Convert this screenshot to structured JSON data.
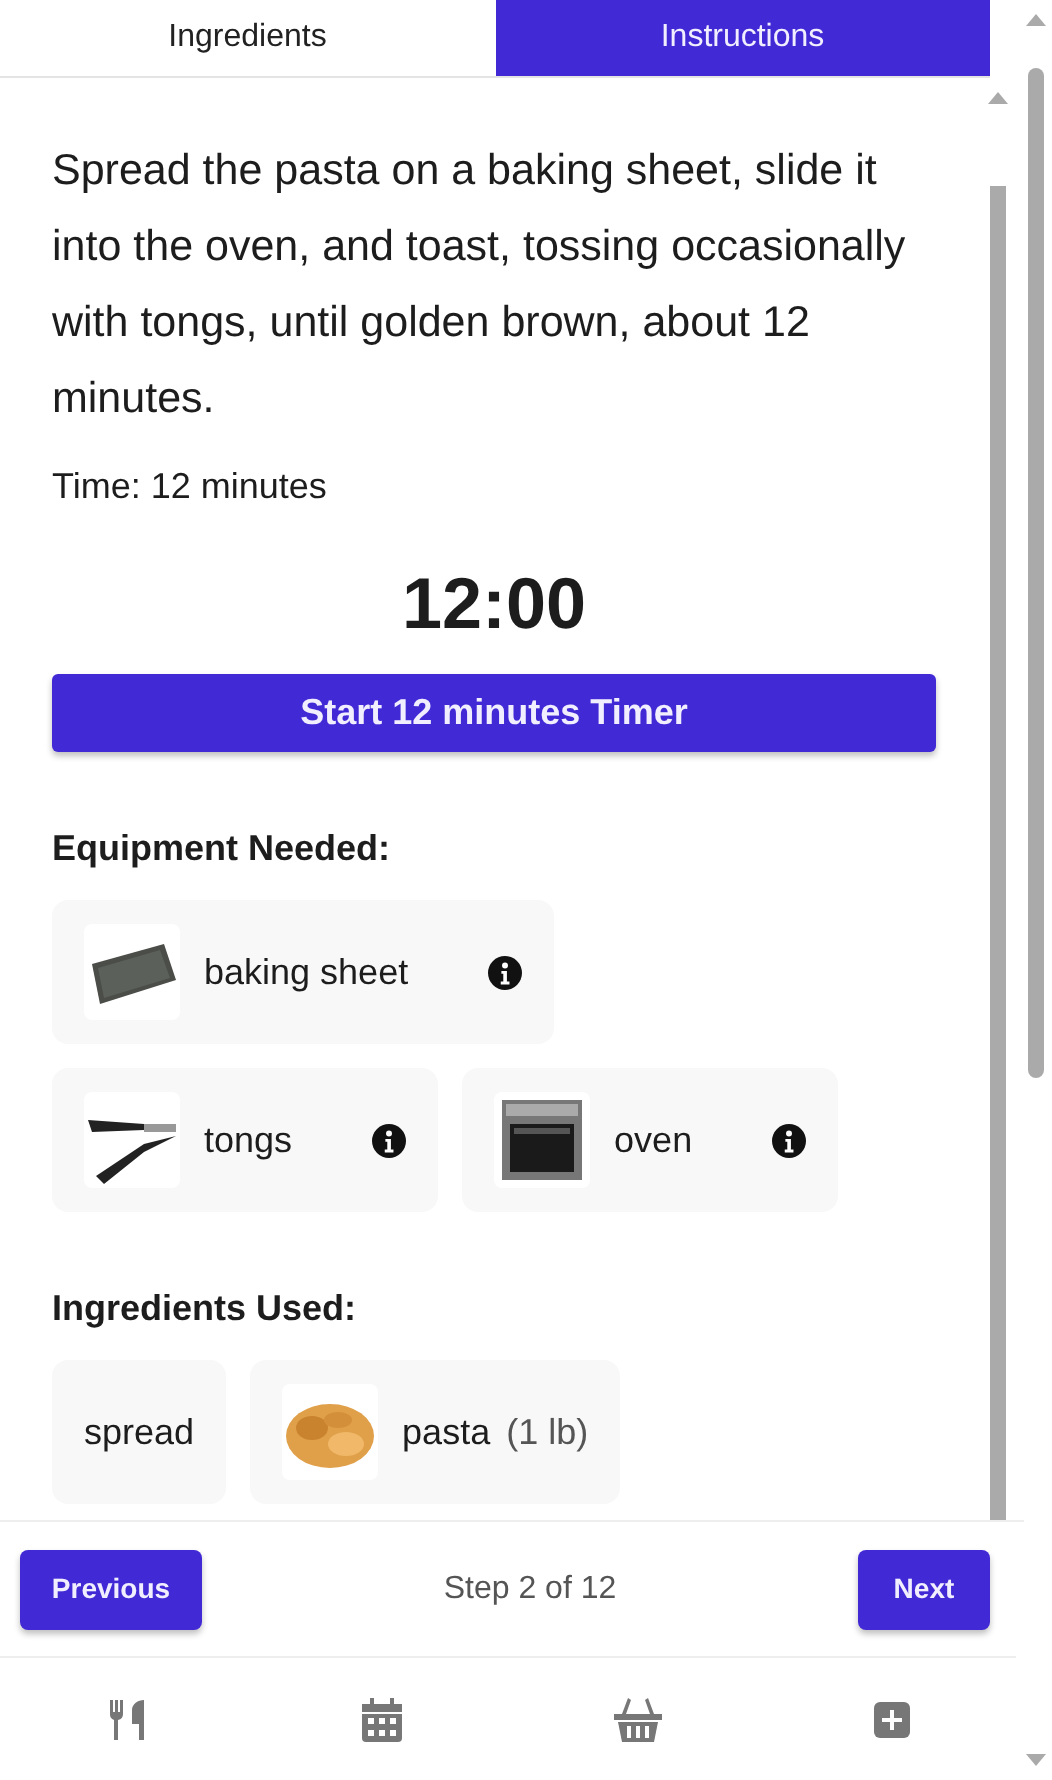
{
  "tabs": [
    {
      "label": "Ingredients",
      "selected": false
    },
    {
      "label": "Instructions",
      "selected": true
    }
  ],
  "instruction": "Spread the pasta on a baking sheet, slide it into the oven, and toast, tossing occasionally with tongs, until golden brown, about 12 minutes.",
  "time": "Time: 12 minutes",
  "timer": "12:00",
  "timer_button": "Start 12 minutes Timer",
  "equipment_heading": "Equipment Needed:",
  "equipment": [
    {
      "name": "baking sheet",
      "kind": "picture"
    },
    {
      "name": "tongs",
      "kind": "picture"
    },
    {
      "name": "oven",
      "kind": "picture"
    }
  ],
  "ingredients_heading": "Ingredients Used:",
  "ingredients": [
    {
      "name": "spread",
      "kind": "text"
    },
    {
      "name": "pasta",
      "amount": "(1 lb)",
      "kind": "picture"
    }
  ],
  "footer": {
    "previous": "Previous",
    "step_label": "Step 2 of 12",
    "next": "Next"
  }
}
